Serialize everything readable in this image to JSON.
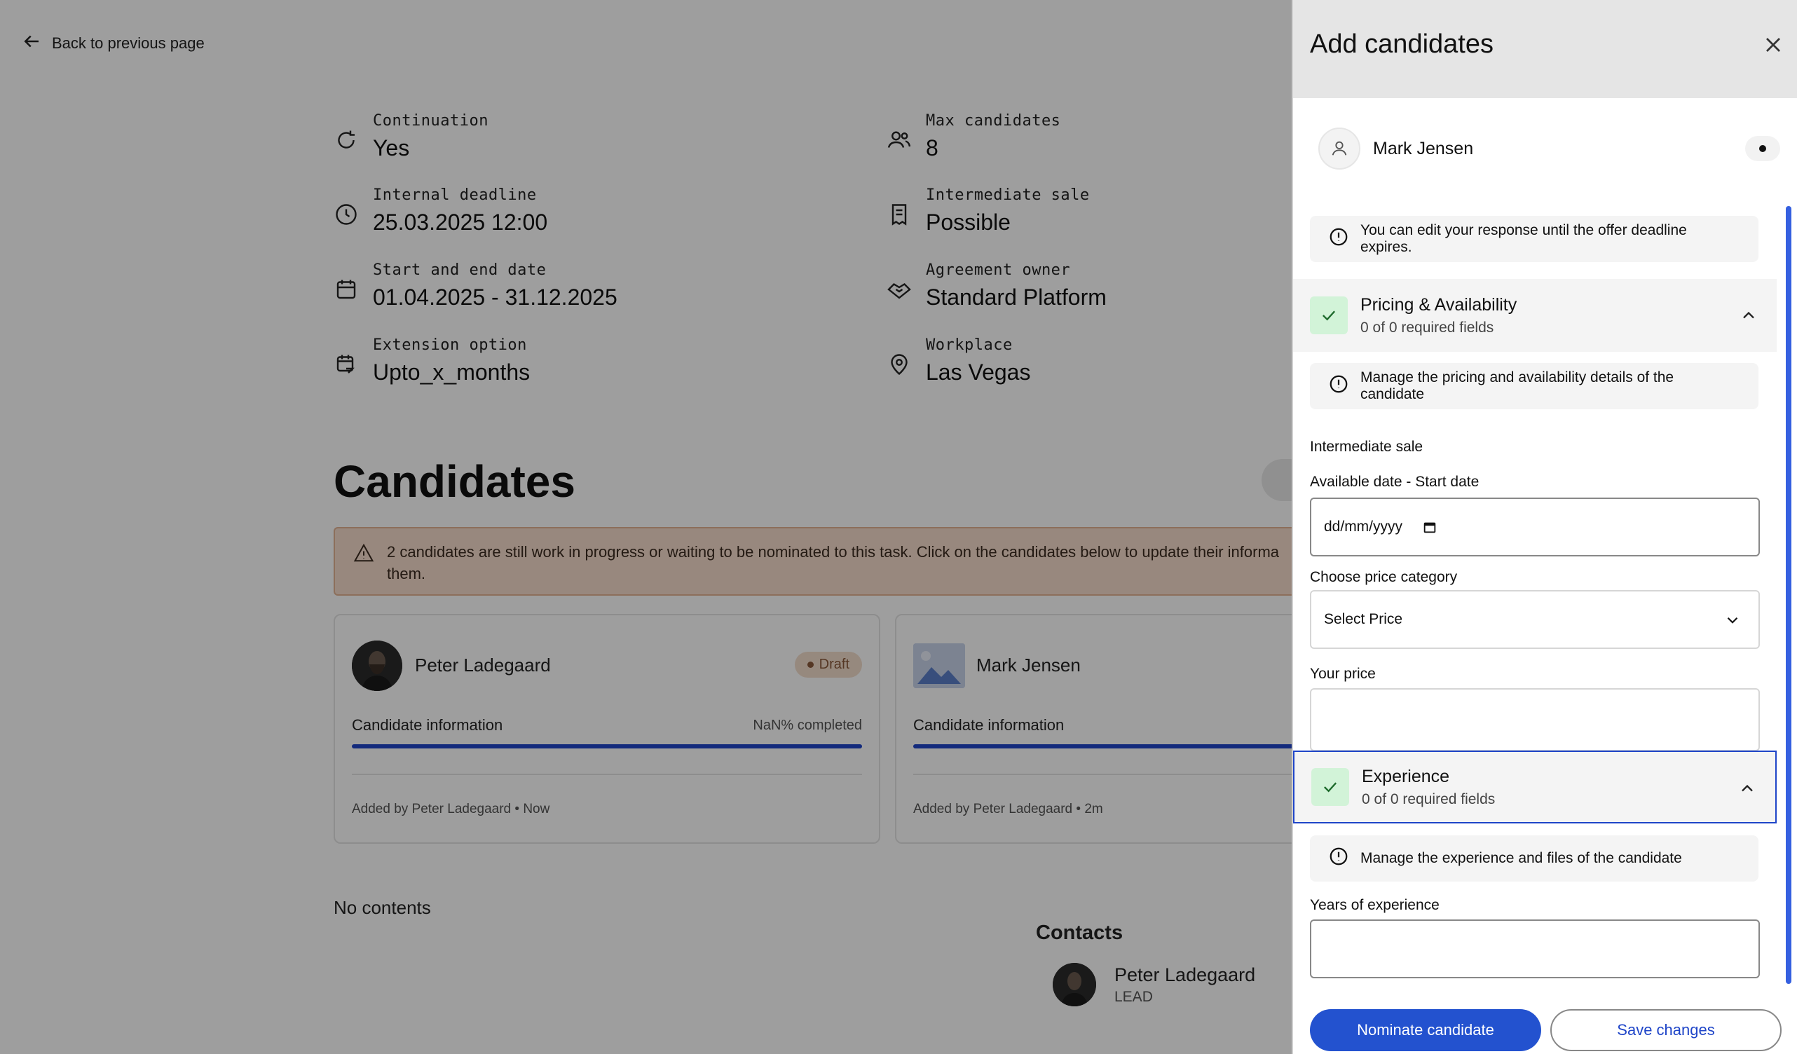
{
  "nav": {
    "back_label": "Back to previous page"
  },
  "details": {
    "continuation": {
      "label": "Continuation",
      "value": "Yes"
    },
    "internal_deadline": {
      "label": "Internal deadline",
      "value": "25.03.2025 12:00"
    },
    "start_end": {
      "label": "Start and end date",
      "value": "01.04.2025 - 31.12.2025"
    },
    "extension": {
      "label": "Extension option",
      "value": "Upto_x_months"
    },
    "max_candidates": {
      "label": "Max candidates",
      "value": "8"
    },
    "intermediate_sale": {
      "label": "Intermediate sale",
      "value": "Possible"
    },
    "agreement_owner": {
      "label": "Agreement owner",
      "value": "Standard Platform"
    },
    "workplace": {
      "label": "Workplace",
      "value": "Las Vegas"
    }
  },
  "candidates": {
    "title": "Candidates",
    "warning": "2 candidates are still work in progress or waiting to be nominated to this task. Click on the candidates below to update their informa them.",
    "cards": [
      {
        "name": "Peter Ladegaard",
        "status": "Draft",
        "info_label": "Candidate information",
        "progress_text": "NaN% completed",
        "added": "Added by Peter Ladegaard • Now"
      },
      {
        "name": "Mark Jensen",
        "info_label": "Candidate information",
        "added": "Added by Peter Ladegaard • 2m"
      }
    ],
    "empty_text": "No contents"
  },
  "contacts": {
    "title": "Contacts",
    "items": [
      {
        "name": "Peter Ladegaard",
        "role": "LEAD"
      }
    ]
  },
  "drawer": {
    "title": "Add candidates",
    "candidate_name": "Mark Jensen",
    "edit_notice": "You can edit your response until the offer deadline expires.",
    "pricing": {
      "title": "Pricing & Availability",
      "subtitle": "0 of 0 required fields",
      "notice": "Manage the pricing and availability details of the candidate",
      "intermediate_label": "Intermediate sale",
      "date_label": "Available date - Start date",
      "date_placeholder": "dd/mm/yyyy",
      "price_category_label": "Choose price category",
      "price_category_value": "Select Price",
      "your_price_label": "Your price",
      "your_price_value": ""
    },
    "experience": {
      "title": "Experience",
      "subtitle": "0 of 0 required fields",
      "notice": "Manage the experience and files of the candidate",
      "years_label": "Years of experience",
      "years_value": ""
    },
    "buttons": {
      "nominate": "Nominate candidate",
      "save": "Save changes"
    }
  },
  "colors": {
    "primary": "#2352cf",
    "warning_bg": "#f5dccb",
    "success_bg": "#d2f3d8",
    "overlay": "rgba(0,0,0,0.38)"
  },
  "icons": [
    "arrow-left-icon",
    "refresh-icon",
    "clock-icon",
    "calendar-icon",
    "extension-icon",
    "users-icon",
    "receipt-icon",
    "handshake-icon",
    "map-pin-icon",
    "warning-icon",
    "close-icon",
    "user-icon",
    "info-icon",
    "check-icon",
    "chevron-up-icon",
    "chevron-down-icon"
  ]
}
